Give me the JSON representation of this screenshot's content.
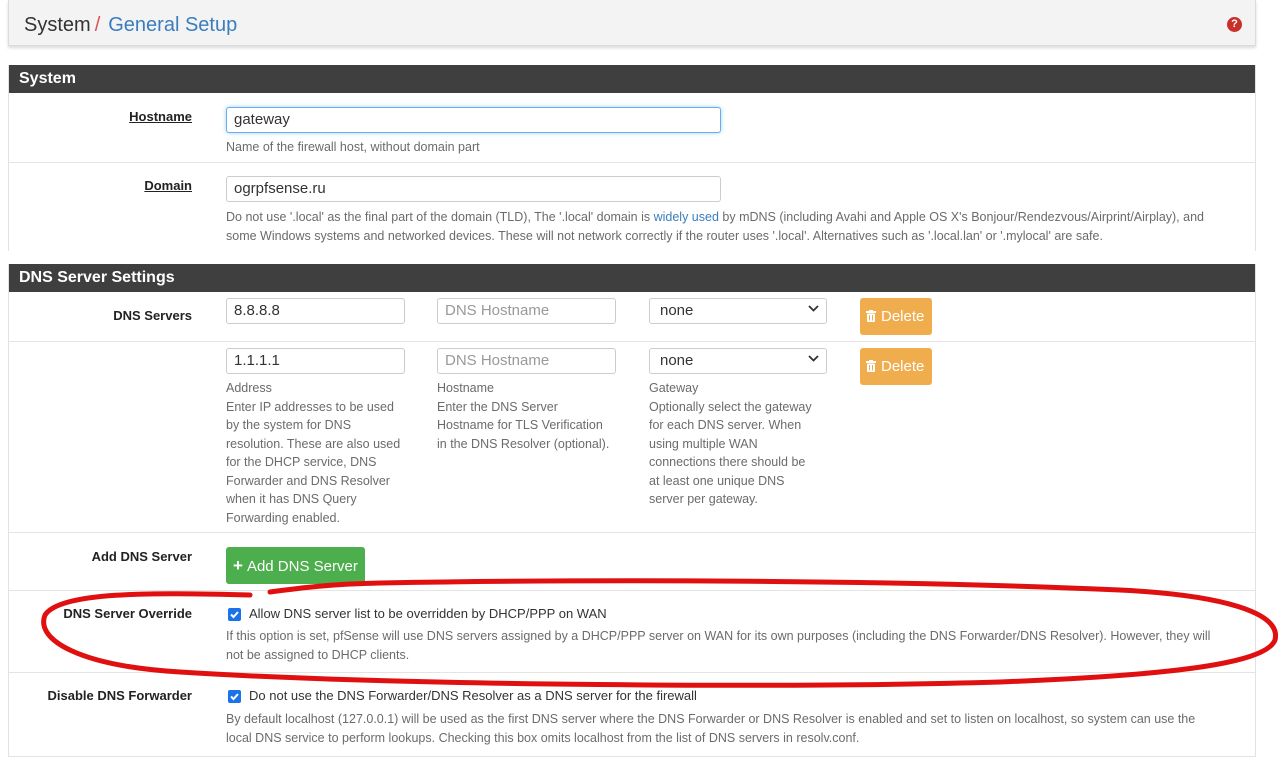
{
  "breadcrumb": {
    "root": "System",
    "separator": "/",
    "current": "General Setup"
  },
  "header": {
    "help_icon": "question-circle-icon",
    "help_glyph": "?"
  },
  "system_section": {
    "title": "System",
    "hostname": {
      "label": "Hostname",
      "value": "gateway",
      "hint": "Name of the firewall host, without domain part"
    },
    "domain": {
      "label": "Domain",
      "value": "ogrpfsense.ru",
      "hint_before_link": "Do not use '.local' as the final part of the domain (TLD), The '.local' domain is",
      "hint_link": "widely used",
      "hint_after_link_line1": "by mDNS (including Avahi and Apple OS X's Bonjour/Rendezvous/Airprint/Airplay), and",
      "hint_line2": "some Windows systems and networked devices. These will not network correctly if the router uses '.local'. Alternatives such as '.local.lan' or '.mylocal' are safe."
    }
  },
  "dns_section": {
    "title": "DNS Server Settings",
    "servers_label": "DNS Servers",
    "servers": [
      {
        "address": "8.8.8.8",
        "hostname_placeholder": "DNS Hostname",
        "gateway": "none",
        "delete_label": "Delete"
      },
      {
        "address": "1.1.1.1",
        "hostname_placeholder": "DNS Hostname",
        "gateway": "none",
        "delete_label": "Delete"
      }
    ],
    "help": {
      "address_title": "Address",
      "address_lines": [
        "Enter IP addresses to be used",
        "by the system for DNS",
        "resolution. These are also used",
        "for the DHCP service, DNS",
        "Forwarder and DNS Resolver",
        "when it has DNS Query",
        "Forwarding enabled."
      ],
      "hostname_title": "Hostname",
      "hostname_lines": [
        "Enter the DNS Server",
        "Hostname for TLS Verification",
        "in the DNS Resolver (optional)."
      ],
      "gateway_title": "Gateway",
      "gateway_lines": [
        "Optionally select the gateway",
        "for each DNS server. When",
        "using multiple WAN",
        "connections there should be",
        "at least one unique DNS",
        "server per gateway."
      ]
    },
    "add_label": "Add DNS Server",
    "add_button": "Add DNS Server",
    "override": {
      "label": "DNS Server Override",
      "checkbox_label": "Allow DNS server list to be overridden by DHCP/PPP on WAN",
      "checked": true,
      "hint_line1": "If this option is set, pfSense will use DNS servers assigned by a DHCP/PPP server on WAN for its own purposes (including the DNS Forwarder/DNS Resolver). However, they will",
      "hint_line2": "not be assigned to DHCP clients."
    },
    "disable_forwarder": {
      "label": "Disable DNS Forwarder",
      "checkbox_label": "Do not use the DNS Forwarder/DNS Resolver as a DNS server for the firewall",
      "checked": true,
      "hint_line1": "By default localhost (127.0.0.1) will be used as the first DNS server where the DNS Forwarder or DNS Resolver is enabled and set to listen on localhost, so system can use the",
      "hint_line2": "local DNS service to perform lookups. Checking this box omits localhost from the list of DNS servers in resolv.conf."
    }
  },
  "colors": {
    "annotation_ring": "#e01010",
    "header_bar": "#3f3f3f",
    "delete": "#f0ad4e",
    "add": "#4cae4c",
    "link": "#3a7dbf"
  }
}
